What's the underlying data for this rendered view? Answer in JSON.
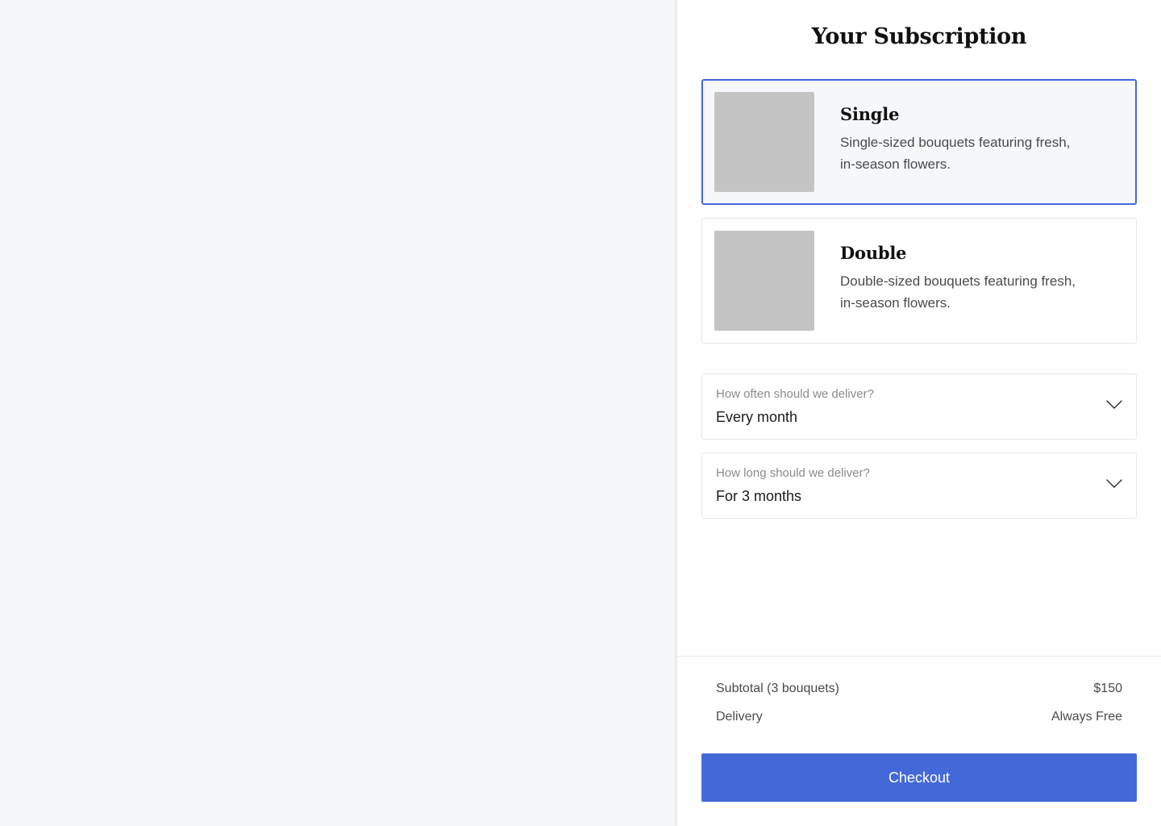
{
  "panel": {
    "title": "Your Subscription"
  },
  "plans": [
    {
      "name": "Single",
      "description": "Single-sized bouquets featuring fresh, in-season flowers.",
      "selected": true
    },
    {
      "name": "Double",
      "description": "Double-sized bouquets featuring fresh, in-season flowers.",
      "selected": false
    }
  ],
  "frequency": {
    "label": "How often should we deliver?",
    "value": "Every month",
    "icon": "chevron-down-icon"
  },
  "duration": {
    "label": "How long should we deliver?",
    "value": "For 3 months",
    "icon": "chevron-down-icon"
  },
  "summary": {
    "subtotal_label": "Subtotal (3 bouquets)",
    "subtotal_value": "$150",
    "delivery_label": "Delivery",
    "delivery_value": "Always Free"
  },
  "checkout": {
    "label": "Checkout"
  },
  "colors": {
    "accent": "#4369d8",
    "selected_bg": "#f5f7fb",
    "thumb_placeholder": "#c4c4c4",
    "backdrop": "#f6f7f9"
  }
}
